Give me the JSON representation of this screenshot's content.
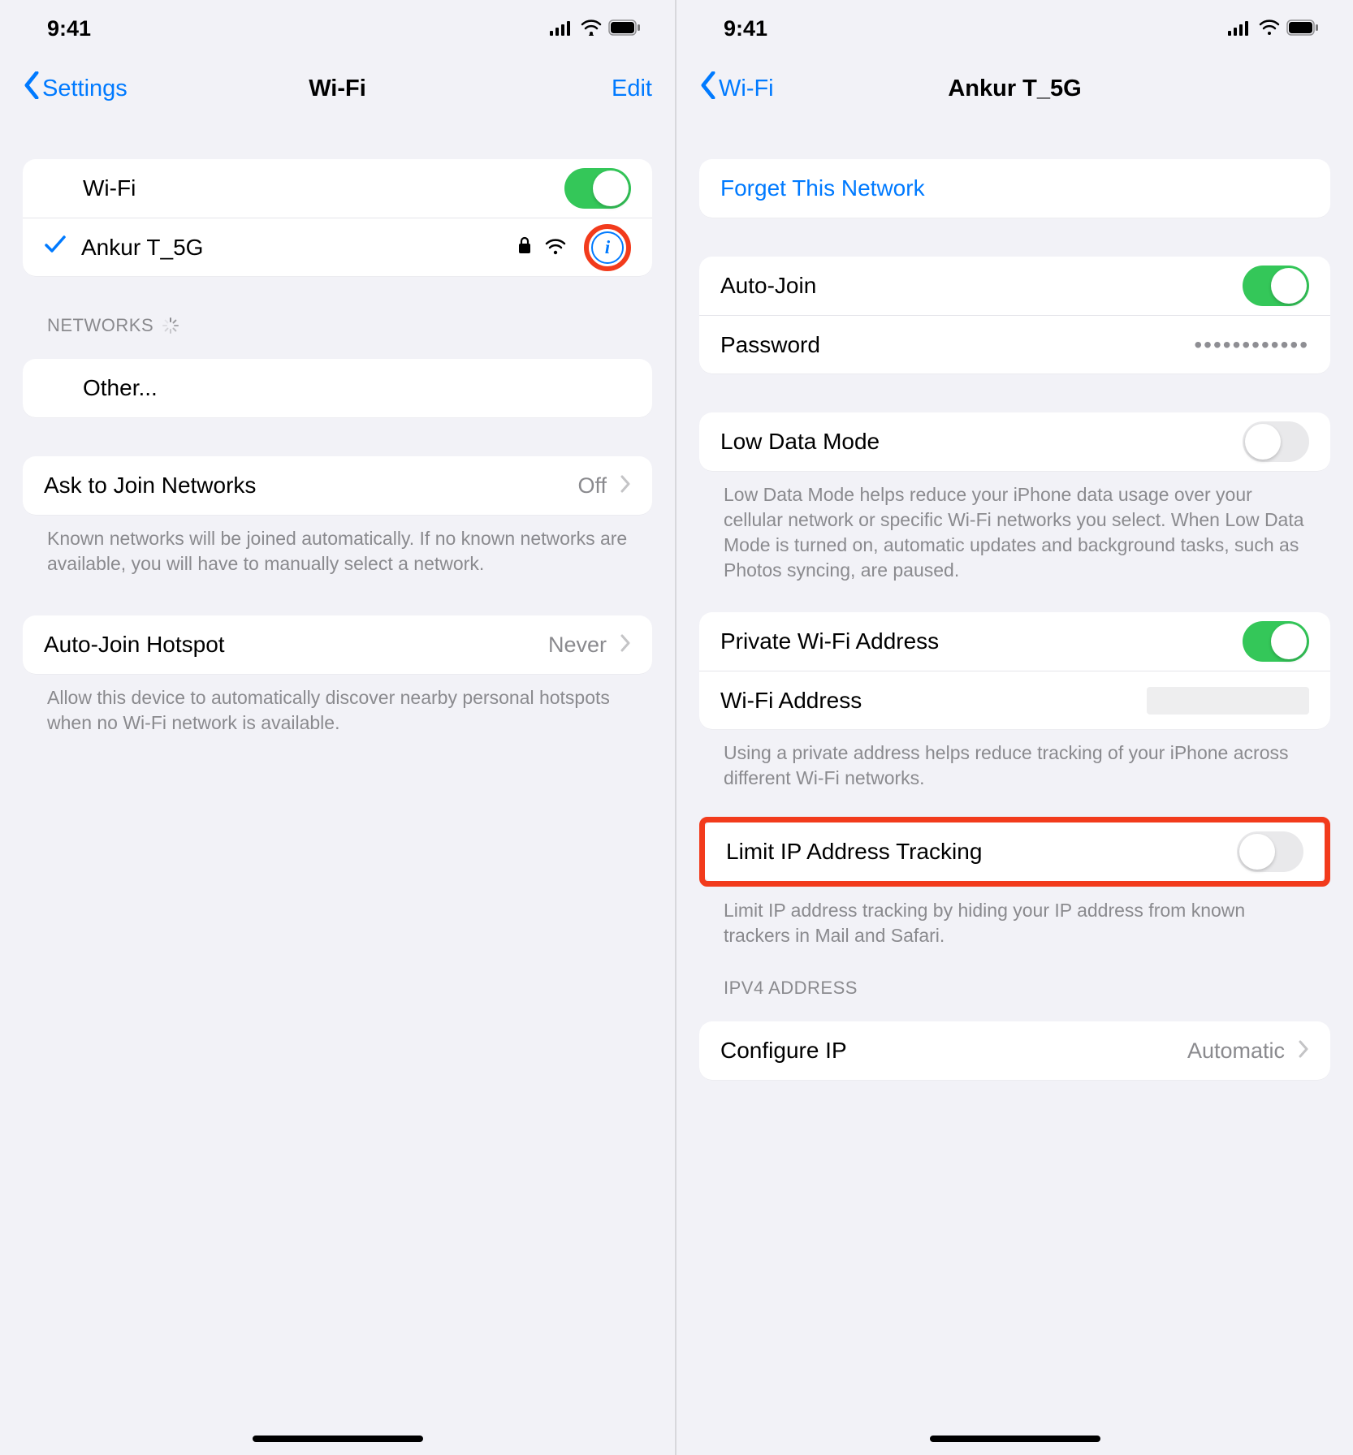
{
  "statusbar": {
    "time": "9:41"
  },
  "left": {
    "back": "Settings",
    "title": "Wi-Fi",
    "edit": "Edit",
    "wifi_row_label": "Wi-Fi",
    "wifi_on": true,
    "connected_network": "Ankur T_5G",
    "networks_header": "NETWORKS",
    "other_label": "Other...",
    "ask_join": {
      "label": "Ask to Join Networks",
      "value": "Off"
    },
    "ask_join_footer": "Known networks will be joined automatically. If no known networks are available, you will have to manually select a network.",
    "autojoin_hotspot": {
      "label": "Auto-Join Hotspot",
      "value": "Never"
    },
    "autojoin_footer": "Allow this device to automatically discover nearby personal hotspots when no Wi-Fi network is available."
  },
  "right": {
    "back": "Wi-Fi",
    "title": "Ankur T_5G",
    "forget": "Forget This Network",
    "autojoin_label": "Auto-Join",
    "autojoin_on": true,
    "password_label": "Password",
    "password_value": "••••••••••••",
    "lowdata_label": "Low Data Mode",
    "lowdata_on": false,
    "lowdata_footer": "Low Data Mode helps reduce your iPhone data usage over your cellular network or specific Wi-Fi networks you select. When Low Data Mode is turned on, automatic updates and background tasks, such as Photos syncing, are paused.",
    "private_addr_label": "Private Wi-Fi Address",
    "private_addr_on": true,
    "wifi_addr_label": "Wi-Fi Address",
    "private_addr_footer": "Using a private address helps reduce tracking of your iPhone across different Wi-Fi networks.",
    "limit_ip_label": "Limit IP Address Tracking",
    "limit_ip_on": false,
    "limit_ip_footer": "Limit IP address tracking by hiding your IP address from known trackers in Mail and Safari.",
    "ipv4_header": "IPV4 ADDRESS",
    "configure_ip": {
      "label": "Configure IP",
      "value": "Automatic"
    }
  }
}
